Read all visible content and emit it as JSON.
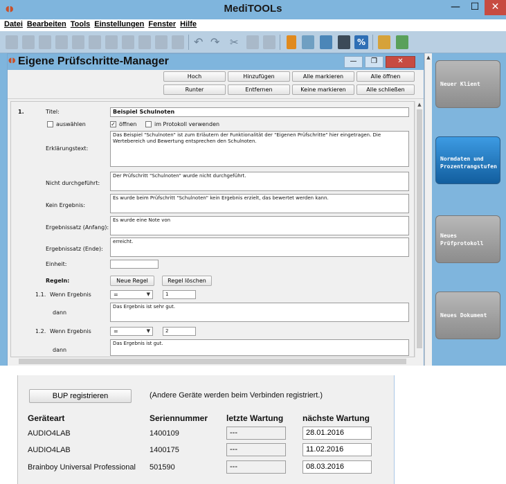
{
  "app": {
    "title": "MediTOOLs",
    "menu": [
      "Datei",
      "Bearbeiten",
      "Tools",
      "Einstellungen",
      "Fenster",
      "Hilfe"
    ],
    "toolbar_percent": "%",
    "colors": {
      "titlebar": "#7fb5dd",
      "active_button": "#1f78c4",
      "close_button": "#c74b41"
    }
  },
  "sidebar": {
    "buttons": [
      {
        "label": "Neuer Klient",
        "active": false
      },
      {
        "label": "Normdaten und Prozentrangstufen",
        "active": true
      },
      {
        "label": "Neues Prüfprotokoll",
        "active": false
      },
      {
        "label": "Neues Dokument",
        "active": false
      }
    ]
  },
  "manager": {
    "title": "Eigene Prüfschritte-Manager",
    "buttons": {
      "hoch": "Hoch",
      "runter": "Runter",
      "hinzufuegen": "Hinzufügen",
      "entfernen": "Entfernen",
      "alle_markieren": "Alle markieren",
      "keine_markieren": "Keine markieren",
      "alle_oeffnen": "Alle öffnen",
      "alle_schliessen": "Alle schließen"
    },
    "step": {
      "number": "1.",
      "titel_label": "Titel:",
      "titel_value": "Beispiel Schulnoten",
      "auswaehlen_label": "auswählen",
      "auswaehlen_checked": false,
      "oeffnen_label": "öffnen",
      "oeffnen_checked": true,
      "protokoll_label": "im Protokoll verwenden",
      "protokoll_checked": false,
      "erklaerung_label": "Erklärungstext:",
      "erklaerung_value": "Das Beispiel \"Schulnoten\" ist zum Erläutern der Funktionalität der \"Eigenen Prüfschritte\" hier eingetragen. Die Wertebereich und Bewertung entsprechen den Schulnoten.",
      "nicht_label": "Nicht durchgeführt:",
      "nicht_value": "Der Prüfschritt \"Schulnoten\" wurde nicht durchgeführt.",
      "kein_label": "Kein Ergebnis:",
      "kein_value": "Es wurde beim Prüfschritt \"Schulnoten\" kein Ergebnis erzielt, das bewertet werden kann.",
      "anfang_label": "Ergebnissatz (Anfang):",
      "anfang_value": "Es wurde eine Note von",
      "ende_label": "Ergebnissatz (Ende):",
      "ende_value": "erreicht.",
      "einheit_label": "Einheit:",
      "einheit_value": "",
      "regeln_label": "Regeln:",
      "neue_regel": "Neue Regel",
      "regel_loeschen": "Regel löschen",
      "rules": [
        {
          "num": "1.1.",
          "wenn": "Wenn Ergebnis",
          "op": "=",
          "value": "1",
          "dann": "dann",
          "text": "Das Ergebnis ist sehr gut."
        },
        {
          "num": "1.2.",
          "wenn": "Wenn Ergebnis",
          "op": "=",
          "value": "2",
          "dann": "dann",
          "text": "Das Ergebnis ist gut."
        }
      ]
    }
  },
  "devices": {
    "register_button": "BUP registrieren",
    "note": "(Andere Geräte werden beim Verbinden registriert.)",
    "headers": {
      "type": "Geräteart",
      "serial": "Seriennummer",
      "last": "letzte Wartung",
      "next": "nächste Wartung"
    },
    "rows": [
      {
        "type": "AUDIO4LAB",
        "serial": "1400109",
        "last": "---",
        "next": "28.01.2016"
      },
      {
        "type": "AUDIO4LAB",
        "serial": "1400175",
        "last": "---",
        "next": "11.02.2016"
      },
      {
        "type": "Brainboy Universal Professional",
        "serial": "501590",
        "last": "---",
        "next": "08.03.2016"
      }
    ]
  }
}
